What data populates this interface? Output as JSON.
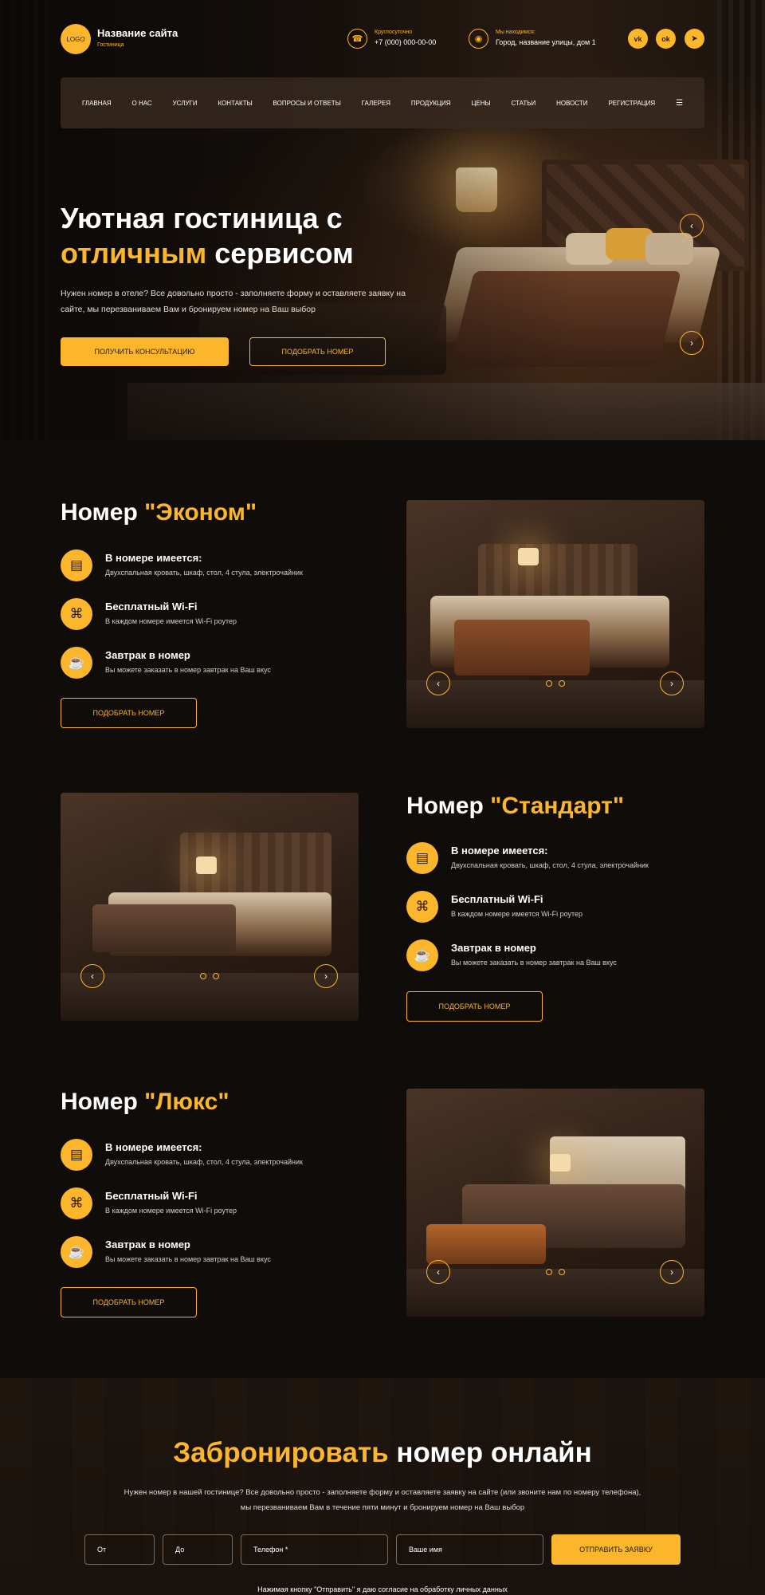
{
  "header": {
    "logo": "LOGO",
    "site_name": "Название сайта",
    "site_sub": "Гостиница",
    "phone_label": "Круглосуточно",
    "phone": "+7 (000) 000-00-00",
    "address_label": "Мы находимся:",
    "address": "Город, название улицы, дом 1",
    "social": [
      "vk",
      "ok",
      "telegram"
    ]
  },
  "nav": {
    "items": [
      "ГЛАВНАЯ",
      "О НАС",
      "УСЛУГИ",
      "КОНТАКТЫ",
      "ВОПРОСЫ И ОТВЕТЫ",
      "ГАЛЕРЕЯ",
      "ПРОДУКЦИЯ",
      "ЦЕНЫ",
      "СТАТЬИ",
      "НОВОСТИ",
      "РЕГИСТРАЦИЯ"
    ],
    "menu_icon": "burger-menu-icon"
  },
  "hero": {
    "title_line1": "Уютная гостиница с",
    "title_accent": "отличным",
    "title_rest": " сервисом",
    "text": "Нужен номер в отеле? Все довольно просто - заполняете форму и оставляете заявку на сайте, мы перезваниваем Вам и бронируем номер на Ваш выбор",
    "btn_primary": "ПОЛУЧИТЬ КОНСУЛЬТАЦИЮ",
    "btn_secondary": "ПОДОБРАТЬ НОМЕР"
  },
  "rooms": [
    {
      "title_prefix": "Номер ",
      "title_name": "\"Эконом\"",
      "features": [
        {
          "icon": "bed-icon",
          "title": "В номере имеется:",
          "desc": "Двухспальная кровать, шкаф, стол, 4 стула, электрочайник"
        },
        {
          "icon": "wifi-icon",
          "title": "Бесплатный Wi-Fi",
          "desc": "В каждом номере имеется Wi-Fi роутер"
        },
        {
          "icon": "coffee-cup-icon",
          "title": "Завтрак в номер",
          "desc": "Вы можете заказать в номер завтрак на Ваш вкус"
        }
      ],
      "button": "ПОДОБРАТЬ НОМЕР"
    },
    {
      "title_prefix": "Номер ",
      "title_name": "\"Стандарт\"",
      "features": [
        {
          "icon": "bed-icon",
          "title": "В номере имеется:",
          "desc": "Двухспальная кровать, шкаф, стол, 4 стула, электрочайник"
        },
        {
          "icon": "wifi-icon",
          "title": "Бесплатный Wi-Fi",
          "desc": "В каждом номере имеется Wi-Fi роутер"
        },
        {
          "icon": "coffee-cup-icon",
          "title": "Завтрак в номер",
          "desc": "Вы можете заказать в номер завтрак на Ваш вкус"
        }
      ],
      "button": "ПОДОБРАТЬ НОМЕР"
    },
    {
      "title_prefix": "Номер ",
      "title_name": "\"Люкс\"",
      "features": [
        {
          "icon": "bed-icon",
          "title": "В номере имеется:",
          "desc": "Двухспальная кровать, шкаф, стол, 4 стула, электрочайник"
        },
        {
          "icon": "wifi-icon",
          "title": "Бесплатный Wi-Fi",
          "desc": "В каждом номере имеется Wi-Fi роутер"
        },
        {
          "icon": "coffee-cup-icon",
          "title": "Завтрак в номер",
          "desc": "Вы можете заказать в номер завтрак на Ваш вкус"
        }
      ],
      "button": "ПОДОБРАТЬ НОМЕР"
    }
  ],
  "booking": {
    "title_accent": "Забронировать",
    "title_rest": " номер онлайн",
    "text": "Нужен номер в нашей гостинице? Все довольно просто - заполняете форму и оставляете заявку на сайте (или звоните нам по номеру телефона), мы перезваниваем Вам в течение пяти минут и бронируем номер на Ваш выбор",
    "from_placeholder": "От",
    "to_placeholder": "До",
    "phone_placeholder": "Телефон *",
    "name_placeholder": "Ваше имя",
    "submit": "ОТПРАВИТЬ ЗАЯВКУ",
    "consent": "Нажимая кнопку \"Отправить\" я даю согласие на обработку личных данных"
  },
  "colors": {
    "accent": "#fbb62b",
    "background": "#100c09",
    "text": "#ffffff"
  }
}
